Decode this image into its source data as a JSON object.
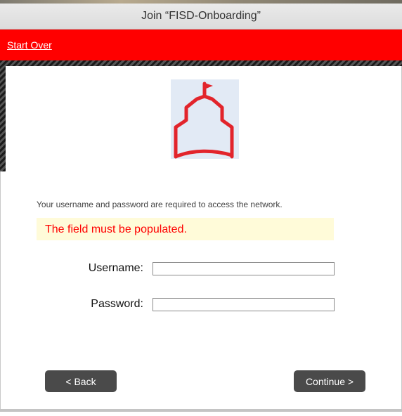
{
  "window": {
    "title": "Join “FISD-Onboarding”"
  },
  "header": {
    "start_over_link": "Start Over",
    "bar_color": "#ff0000"
  },
  "logo": {
    "icon": "schoolhouse-icon",
    "stroke_color": "#e2242b"
  },
  "form": {
    "info_text": "Your username and password are required to access the network.",
    "error_message": "The field must be populated.",
    "username_label": "Username:",
    "username_value": "",
    "password_label": "Password:",
    "password_value": ""
  },
  "buttons": {
    "back_label": "< Back",
    "continue_label": "Continue >"
  }
}
